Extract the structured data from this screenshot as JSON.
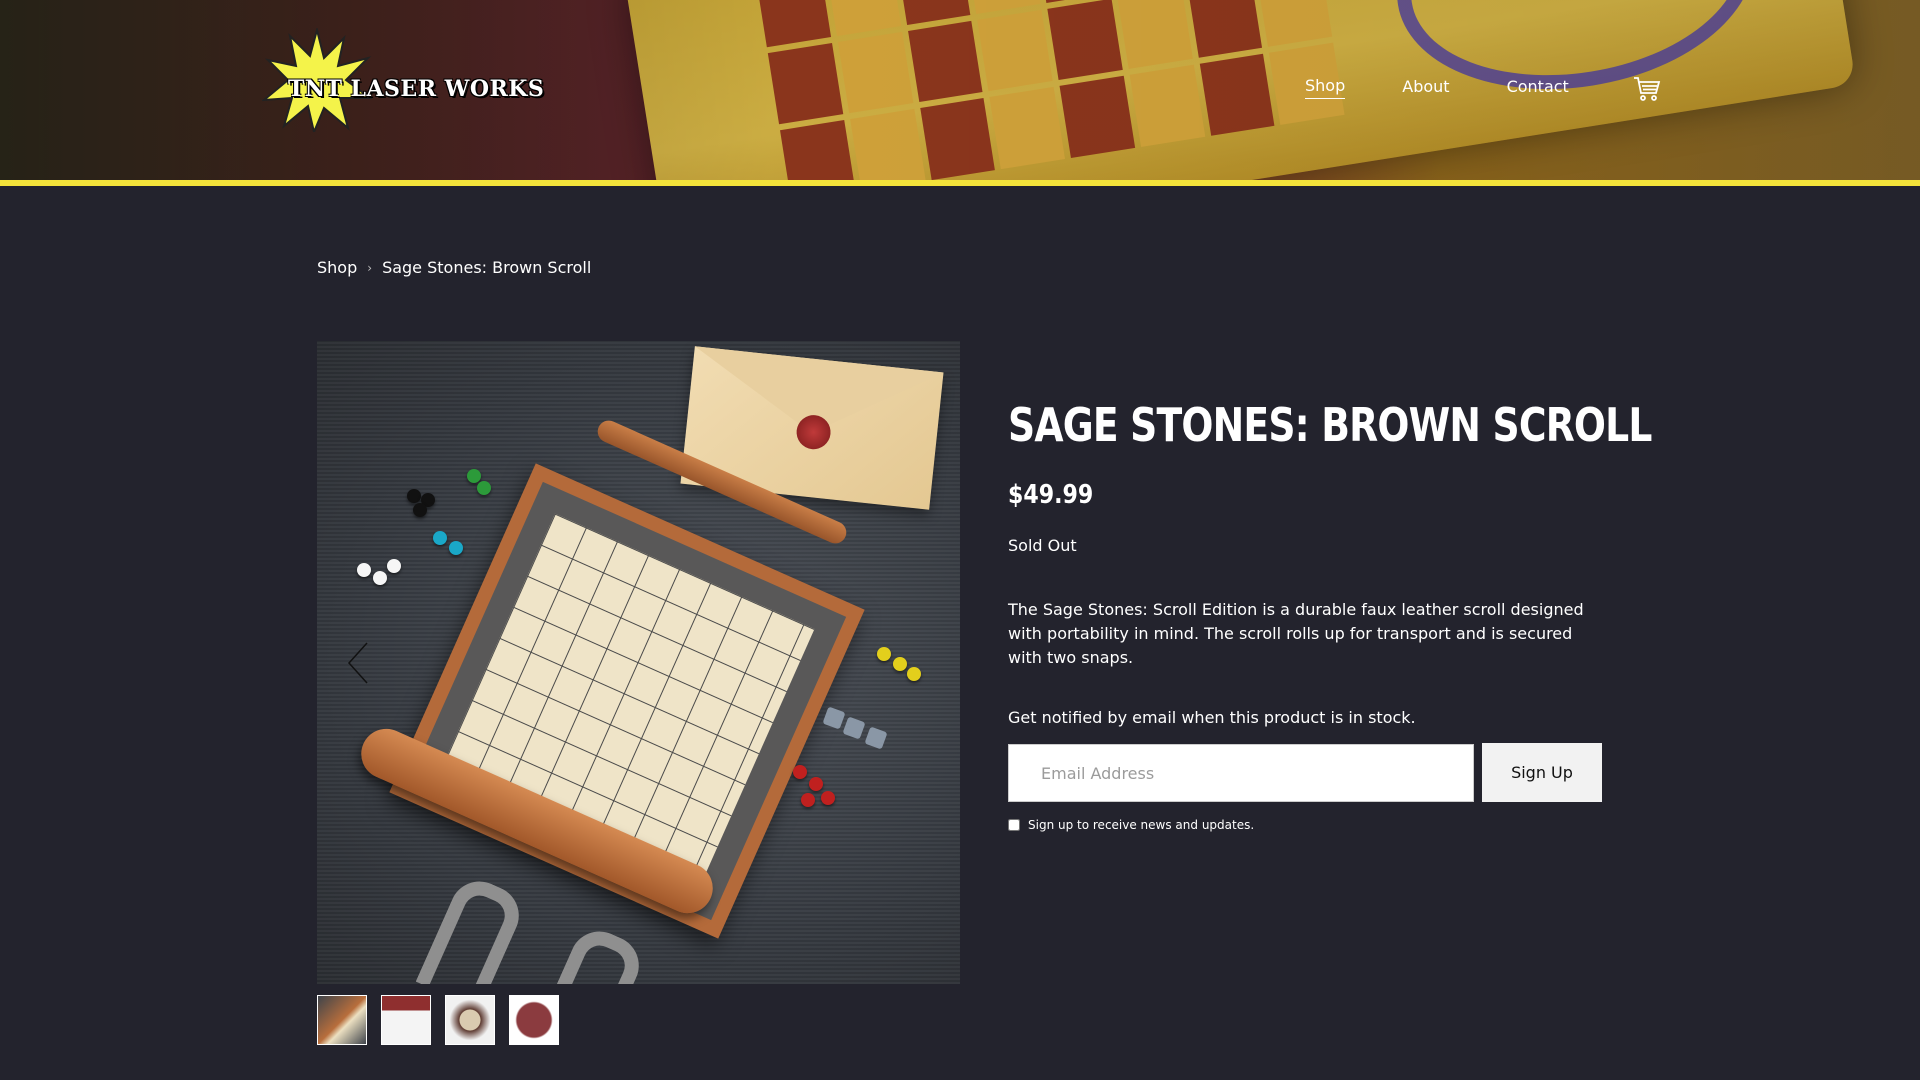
{
  "brand": {
    "logo_text": "TNT LASER WORKS"
  },
  "nav": {
    "items": [
      {
        "label": "Shop",
        "active": true
      },
      {
        "label": "About",
        "active": false
      },
      {
        "label": "Contact",
        "active": false
      }
    ],
    "cart_icon": "shopping-cart-icon"
  },
  "breadcrumb": {
    "items": [
      "Shop",
      "Sage Stones: Brown Scroll"
    ],
    "separator": "›"
  },
  "product": {
    "title": "SAGE STONES: BROWN SCROLL",
    "price": "$49.99",
    "stock_status": "Sold Out",
    "description": "The Sage Stones: Scroll Edition is a durable faux leather scroll designed with portability in mind. The scroll rolls up for transport and is secured with two snaps.",
    "thumbnail_count": 4
  },
  "notify": {
    "text": "Get notified by email when this product is in stock.",
    "email_placeholder": "Email Address",
    "button_label": "Sign Up",
    "newsletter_label": "Sign up to receive news and updates."
  },
  "colors": {
    "background": "#23232d",
    "accent_stripe": "#f3e33a",
    "text": "#ffffff"
  }
}
